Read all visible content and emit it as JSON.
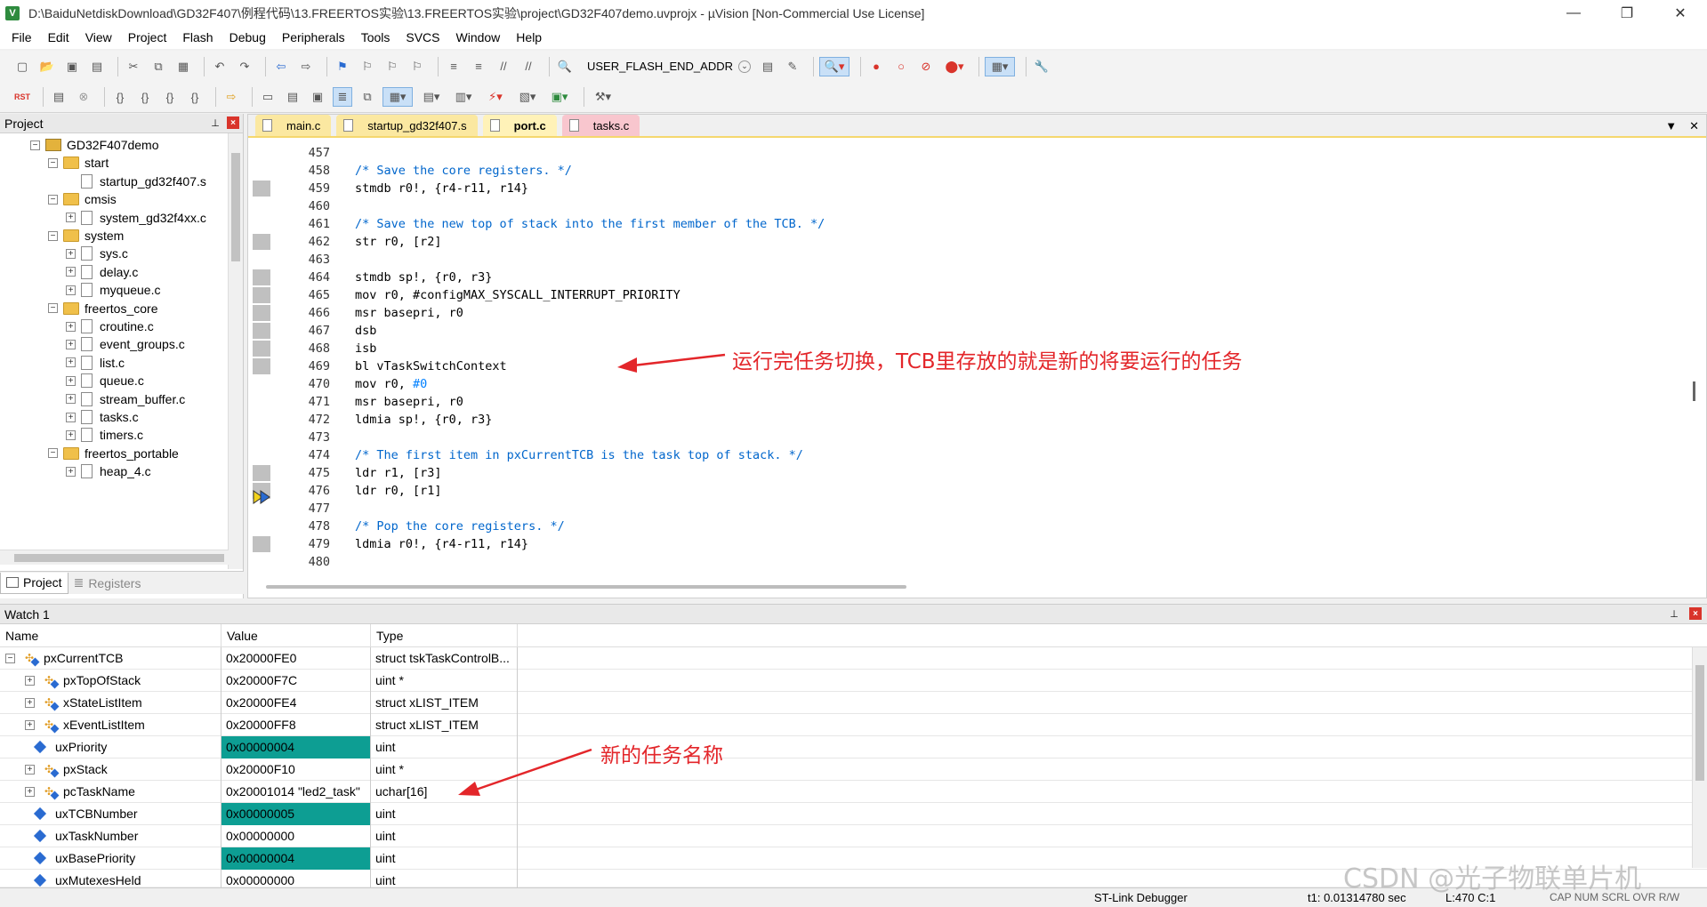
{
  "window": {
    "title": "D:\\BaiduNetdiskDownload\\GD32F407\\例程代码\\13.FREERTOS实验\\13.FREERTOS实验\\project\\GD32F407demo.uvprojx - µVision  [Non-Commercial Use License]",
    "app_icon_letter": "V",
    "minimize": "—",
    "restore": "❐",
    "close": "✕"
  },
  "menu": [
    "File",
    "Edit",
    "View",
    "Project",
    "Flash",
    "Debug",
    "Peripherals",
    "Tools",
    "SVCS",
    "Window",
    "Help"
  ],
  "toolbar": {
    "target_combo": "USER_FLASH_END_ADDR",
    "rst_label": "RST"
  },
  "project_panel": {
    "title": "Project",
    "tree": [
      {
        "label": "GD32F407demo",
        "kind": "project",
        "level": 1,
        "toggle": "−"
      },
      {
        "label": "start",
        "kind": "folder",
        "level": 2,
        "toggle": "−"
      },
      {
        "label": "startup_gd32f407.s",
        "kind": "file",
        "level": 3,
        "toggle": ""
      },
      {
        "label": "cmsis",
        "kind": "folder",
        "level": 2,
        "toggle": "−"
      },
      {
        "label": "system_gd32f4xx.c",
        "kind": "file",
        "level": 3,
        "toggle": "+"
      },
      {
        "label": "system",
        "kind": "folder",
        "level": 2,
        "toggle": "−"
      },
      {
        "label": "sys.c",
        "kind": "file",
        "level": 3,
        "toggle": "+"
      },
      {
        "label": "delay.c",
        "kind": "file",
        "level": 3,
        "toggle": "+"
      },
      {
        "label": "myqueue.c",
        "kind": "file",
        "level": 3,
        "toggle": "+"
      },
      {
        "label": "freertos_core",
        "kind": "folder",
        "level": 2,
        "toggle": "−"
      },
      {
        "label": "croutine.c",
        "kind": "file",
        "level": 3,
        "toggle": "+"
      },
      {
        "label": "event_groups.c",
        "kind": "file",
        "level": 3,
        "toggle": "+"
      },
      {
        "label": "list.c",
        "kind": "file",
        "level": 3,
        "toggle": "+"
      },
      {
        "label": "queue.c",
        "kind": "file",
        "level": 3,
        "toggle": "+"
      },
      {
        "label": "stream_buffer.c",
        "kind": "file",
        "level": 3,
        "toggle": "+"
      },
      {
        "label": "tasks.c",
        "kind": "file",
        "level": 3,
        "toggle": "+"
      },
      {
        "label": "timers.c",
        "kind": "file",
        "level": 3,
        "toggle": "+"
      },
      {
        "label": "freertos_portable",
        "kind": "folder",
        "level": 2,
        "toggle": "−"
      },
      {
        "label": "heap_4.c",
        "kind": "file",
        "level": 3,
        "toggle": "+"
      }
    ],
    "tabs": [
      "Project",
      "Registers"
    ]
  },
  "editor": {
    "tabs": [
      "main.c",
      "startup_gd32f407.s",
      "port.c",
      "tasks.c"
    ],
    "active_tab": "port.c",
    "lines": [
      {
        "no": "457",
        "code": "",
        "cls": ""
      },
      {
        "no": "458",
        "code": "/* Save the core registers. */",
        "cls": "cmt"
      },
      {
        "no": "459",
        "code": "stmdb r0!, {r4-r11, r14}",
        "cls": ""
      },
      {
        "no": "460",
        "code": "",
        "cls": ""
      },
      {
        "no": "461",
        "code": "/* Save the new top of stack into the first member of the TCB. */",
        "cls": "cmt"
      },
      {
        "no": "462",
        "code": "str r0, [r2]",
        "cls": ""
      },
      {
        "no": "463",
        "code": "",
        "cls": ""
      },
      {
        "no": "464",
        "code": "stmdb sp!, {r0, r3}",
        "cls": ""
      },
      {
        "no": "465",
        "code": "mov r0, #configMAX_SYSCALL_INTERRUPT_PRIORITY",
        "cls": ""
      },
      {
        "no": "466",
        "code": "msr basepri, r0",
        "cls": ""
      },
      {
        "no": "467",
        "code": "dsb",
        "cls": ""
      },
      {
        "no": "468",
        "code": "isb",
        "cls": ""
      },
      {
        "no": "469",
        "code": "bl vTaskSwitchContext",
        "cls": ""
      },
      {
        "no": "470",
        "code": "mov r0, #0",
        "cls": "imm"
      },
      {
        "no": "471",
        "code": "msr basepri, r0",
        "cls": ""
      },
      {
        "no": "472",
        "code": "ldmia sp!, {r0, r3}",
        "cls": ""
      },
      {
        "no": "473",
        "code": "",
        "cls": ""
      },
      {
        "no": "474",
        "code": "/* The first item in pxCurrentTCB is the task top of stack. */",
        "cls": "cmt"
      },
      {
        "no": "475",
        "code": "ldr r1, [r3]",
        "cls": ""
      },
      {
        "no": "476",
        "code": "ldr r0, [r1]",
        "cls": ""
      },
      {
        "no": "477",
        "code": "",
        "cls": ""
      },
      {
        "no": "478",
        "code": "/* Pop the core registers. */",
        "cls": "cmt"
      },
      {
        "no": "479",
        "code": "ldmia r0!, {r4-r11, r14}",
        "cls": ""
      },
      {
        "no": "480",
        "code": "",
        "cls": ""
      }
    ],
    "current_line": "470"
  },
  "watch": {
    "title": "Watch 1",
    "columns": [
      "Name",
      "Value",
      "Type"
    ],
    "rows": [
      {
        "name": "pxCurrentTCB",
        "value": "0x20000FE0",
        "type": "struct tskTaskControlB...",
        "icon": "struct",
        "toggle": "−",
        "indent": 0,
        "hl": false
      },
      {
        "name": "pxTopOfStack",
        "value": "0x20000F7C",
        "type": "uint *",
        "icon": "struct",
        "toggle": "+",
        "indent": 1,
        "hl": false
      },
      {
        "name": "xStateListItem",
        "value": "0x20000FE4",
        "type": "struct xLIST_ITEM",
        "icon": "struct",
        "toggle": "+",
        "indent": 1,
        "hl": false
      },
      {
        "name": "xEventListItem",
        "value": "0x20000FF8",
        "type": "struct xLIST_ITEM",
        "icon": "struct",
        "toggle": "+",
        "indent": 1,
        "hl": false
      },
      {
        "name": "uxPriority",
        "value": "0x00000004",
        "type": "uint",
        "icon": "var",
        "toggle": "",
        "indent": 1,
        "hl": true
      },
      {
        "name": "pxStack",
        "value": "0x20000F10",
        "type": "uint *",
        "icon": "struct",
        "toggle": "+",
        "indent": 1,
        "hl": false
      },
      {
        "name": "pcTaskName",
        "value": "0x20001014 \"led2_task\"",
        "type": "uchar[16]",
        "icon": "struct",
        "toggle": "+",
        "indent": 1,
        "hl": false
      },
      {
        "name": "uxTCBNumber",
        "value": "0x00000005",
        "type": "uint",
        "icon": "var",
        "toggle": "",
        "indent": 1,
        "hl": true
      },
      {
        "name": "uxTaskNumber",
        "value": "0x00000000",
        "type": "uint",
        "icon": "var",
        "toggle": "",
        "indent": 1,
        "hl": false
      },
      {
        "name": "uxBasePriority",
        "value": "0x00000004",
        "type": "uint",
        "icon": "var",
        "toggle": "",
        "indent": 1,
        "hl": true
      },
      {
        "name": "uxMutexesHeld",
        "value": "0x00000000",
        "type": "uint",
        "icon": "var",
        "toggle": "",
        "indent": 1,
        "hl": false
      }
    ]
  },
  "status": {
    "debugger": "ST-Link Debugger",
    "time": "t1: 0.01314780 sec",
    "position": "L:470 C:1",
    "indicators": "CAP  NUM  SCRL  OVR  R/W"
  },
  "annotations": {
    "context_switch": "运行完任务切换，TCB里存放的就是新的将要运行的任务",
    "task_name": "新的任务名称",
    "color": "#e3262a"
  },
  "watermark": "CSDN @光子物联单片机",
  "colors": {
    "watch_highlight": "#0d9e93",
    "comment": "#0066cc",
    "tab_active": "#fff2b8",
    "tab_tasks": "#f8c6ce"
  }
}
